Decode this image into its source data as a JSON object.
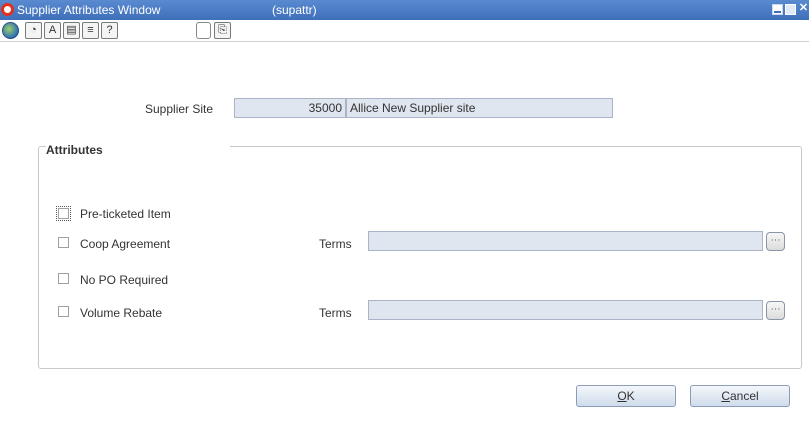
{
  "window": {
    "title": "Supplier Attributes Window",
    "code": "(supattr)"
  },
  "toolbar": {
    "icons": [
      "globe-icon",
      "spin-icon",
      "translate-icon",
      "calendar-icon",
      "print-icon",
      "help-icon",
      "new-document-icon"
    ]
  },
  "form": {
    "supplier_site_label": "Supplier Site",
    "supplier_site_id": "35000",
    "supplier_site_name": "Allice New Supplier site",
    "attributes_title": "Attributes",
    "attributes": [
      {
        "label": "Pre-ticketed Item",
        "checked": false
      },
      {
        "label": "Coop Agreement",
        "checked": false,
        "terms_label": "Terms",
        "terms_value": ""
      },
      {
        "label": "No PO Required",
        "checked": false
      },
      {
        "label": "Volume Rebate",
        "checked": false,
        "terms_label": "Terms",
        "terms_value": ""
      }
    ]
  },
  "buttons": {
    "ok_key": "O",
    "ok_rest": "K",
    "cancel_key": "C",
    "cancel_rest": "ancel"
  },
  "colors": {
    "titlebar": "#3e6fb9",
    "field_bg": "#dfe6ef",
    "button_bg": "#cfdceb"
  }
}
